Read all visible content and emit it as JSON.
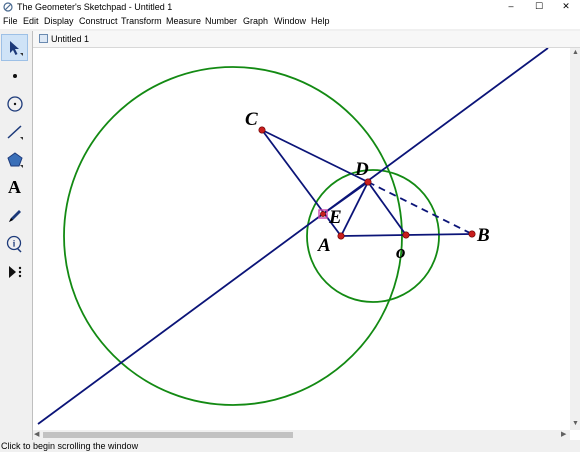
{
  "window": {
    "title": "The Geometer's Sketchpad - Untitled 1",
    "minimize": "–",
    "maximize": "☐",
    "close": "✕"
  },
  "menu": [
    "File",
    "Edit",
    "Display",
    "Construct",
    "Transform",
    "Measure",
    "Number",
    "Graph",
    "Window",
    "Help"
  ],
  "toolbox": [
    "arrow-tool",
    "point-tool",
    "compass-tool",
    "straightedge-tool",
    "polygon-tool",
    "text-tool",
    "marker-tool",
    "information-tool",
    "custom-tool"
  ],
  "toolbox_text_glyph": "A",
  "document": {
    "tab_title": "Untitled 1"
  },
  "figure": {
    "labels": {
      "A": "A",
      "B": "B",
      "C": "C",
      "D": "D",
      "E": "E",
      "O": "o"
    },
    "colors": {
      "circle": "#138a13",
      "segment": "#0b1478",
      "point": "#c81e1e",
      "selected_point": "#cc44aa"
    }
  },
  "status": "Click to begin scrolling the window"
}
